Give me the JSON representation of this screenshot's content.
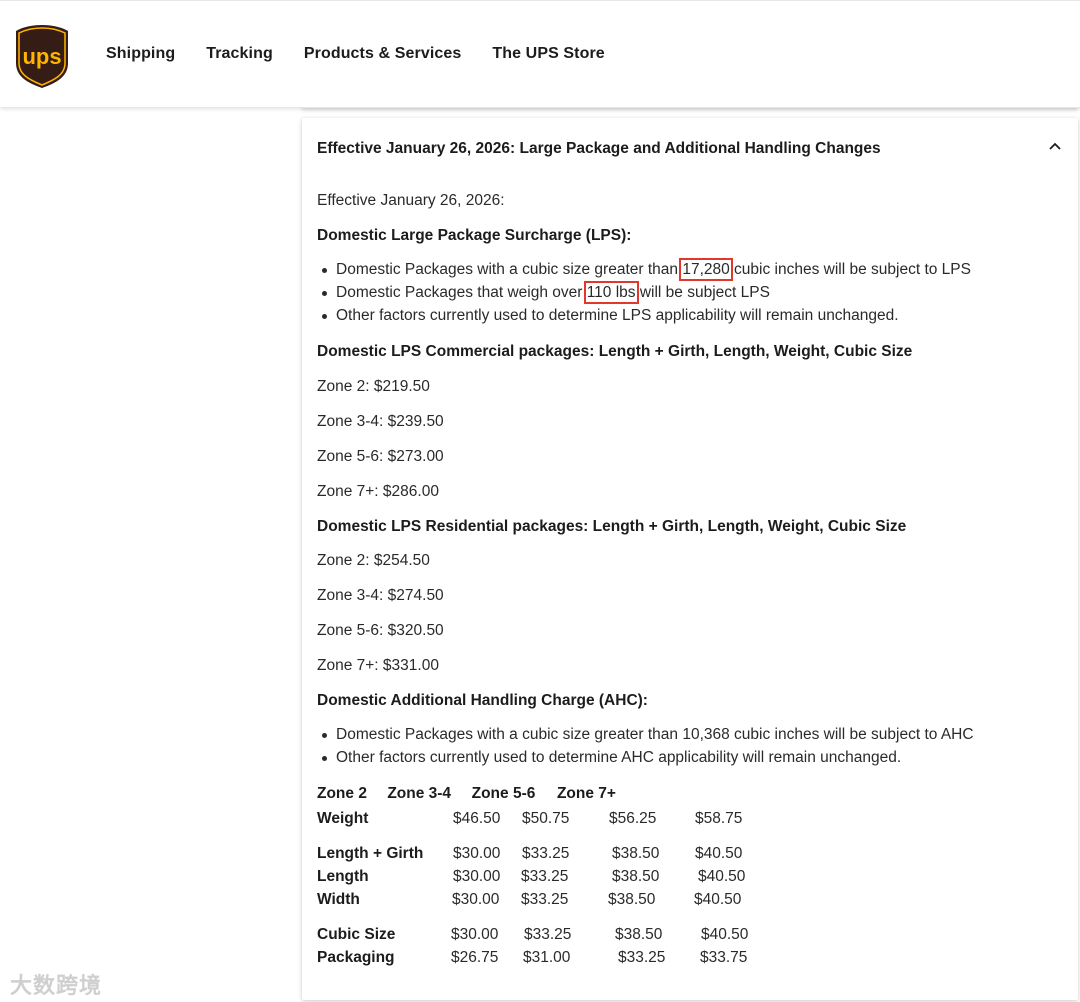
{
  "header": {
    "logo_text": "ups",
    "nav": [
      "Shipping",
      "Tracking",
      "Products & Services",
      "The UPS Store"
    ]
  },
  "colors": {
    "ups_brown": "#351c15",
    "ups_gold": "#ffb500",
    "highlight_red": "#e0382a"
  },
  "card": {
    "title": "Effective January 26, 2026: Large Package and Additional Handling Changes",
    "intro": "Effective January 26, 2026:",
    "lps_heading": "Domestic Large Package Surcharge (LPS):",
    "lps_bullets": {
      "b1_pre": "Domestic Packages with a cubic size greater than ",
      "b1_hl": "17,280",
      "b1_post": " cubic inches will be subject to LPS",
      "b2_pre": "Domestic Packages that weigh over ",
      "b2_hl": "110 lbs",
      "b2_post": " will be subject LPS",
      "b3": "Other factors currently used to determine LPS applicability will remain unchanged."
    },
    "commercial_heading": "Domestic LPS Commercial packages: Length + Girth, Length, Weight, Cubic Size",
    "commercial_zones": [
      "Zone 2: $219.50",
      "Zone 3-4: $239.50",
      "Zone 5-6: $273.00",
      "Zone 7+: $286.00"
    ],
    "residential_heading": "Domestic LPS Residential packages: Length + Girth, Length, Weight, Cubic Size",
    "residential_zones": [
      "Zone 2: $254.50",
      "Zone 3-4: $274.50",
      "Zone 5-6: $320.50",
      "Zone 7+: $331.00"
    ],
    "ahc_heading": "Domestic Additional Handling Charge (AHC):",
    "ahc_bullets": [
      "Domestic Packages with a cubic size greater than 10,368 cubic inches will be subject to AHC",
      "Other factors currently used to determine AHC applicability will remain unchanged."
    ],
    "table": {
      "headers": [
        "Zone 2",
        "Zone 3-4",
        "Zone 5-6",
        "Zone 7+"
      ],
      "rows": [
        {
          "label": "Weight",
          "values": [
            "$46.50",
            "$50.75",
            "$56.25",
            "$58.75"
          ]
        },
        {
          "label": "Length + Girth",
          "values": [
            "$30.00",
            "$33.25",
            "$38.50",
            "$40.50"
          ]
        },
        {
          "label": "Length",
          "values": [
            "$30.00",
            "$33.25",
            "$38.50",
            "$40.50"
          ]
        },
        {
          "label": "Width",
          "values": [
            "$30.00",
            "$33.25",
            "$38.50",
            "$40.50"
          ]
        },
        {
          "label": "Cubic Size",
          "values": [
            "$30.00",
            "$33.25",
            "$38.50",
            "$40.50"
          ]
        },
        {
          "label": "Packaging",
          "values": [
            "$26.75",
            "$31.00",
            "$33.25",
            "$33.75"
          ]
        }
      ]
    }
  },
  "watermark": "大数跨境"
}
